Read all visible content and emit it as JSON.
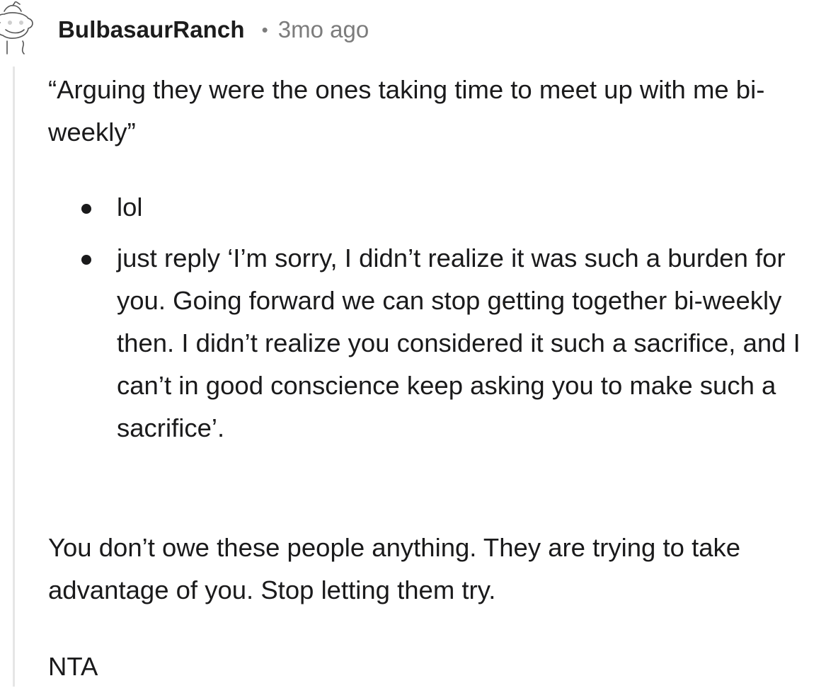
{
  "comment": {
    "username": "BulbasaurRanch",
    "separator": "•",
    "timestamp": "3mo ago",
    "avatar_icon": "snoo-avatar-icon",
    "quote": "“Arguing they were the ones taking time to meet up with me bi-weekly”",
    "bullets": [
      "lol",
      "just reply ‘I’m sorry, I didn’t realize it was such a burden for you. Going forward we can stop getting together bi-weekly then. I didn’t realize you considered it such a sacrifice, and I can’t in good conscience keep asking you to make such a sacrifice’."
    ],
    "paragraph": "You don’t owe these people anything. They are trying to take advantage of you. Stop letting them try.",
    "verdict": "NTA"
  },
  "colors": {
    "text": "#1a1a1b",
    "meta": "#7c7c7c",
    "thread_line": "#e6e6e6"
  }
}
